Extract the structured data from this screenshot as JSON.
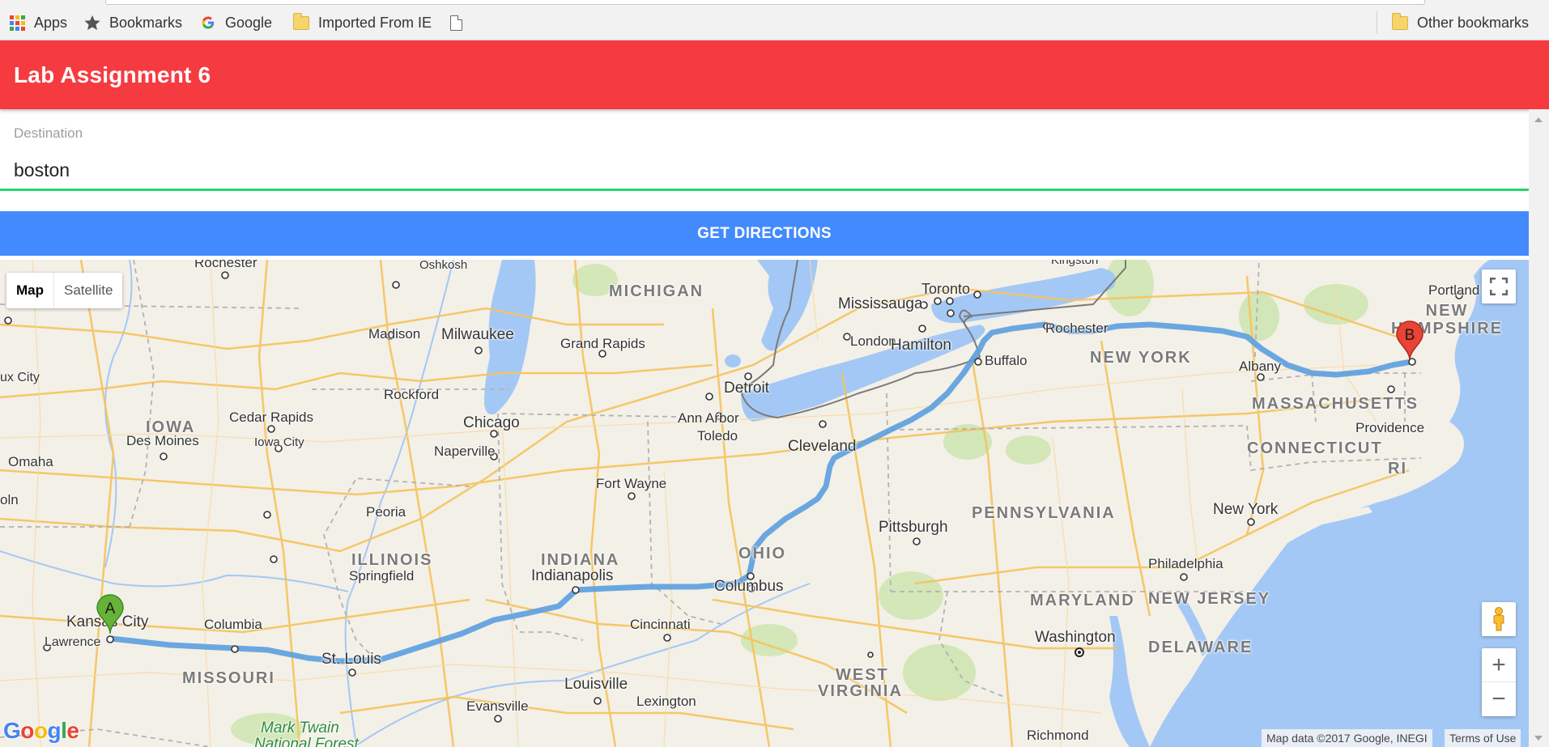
{
  "bookmarks_bar": {
    "items": [
      {
        "label": "Apps",
        "icon": "apps-grid-icon"
      },
      {
        "label": "Bookmarks",
        "icon": "star-icon"
      },
      {
        "label": "Google",
        "icon": "google-g-icon"
      },
      {
        "label": "Imported From IE",
        "icon": "folder-icon"
      },
      {
        "label": "",
        "icon": "page-icon"
      }
    ],
    "other": {
      "label": "Other bookmarks",
      "icon": "folder-icon"
    }
  },
  "header": {
    "title": "Lab Assignment 6",
    "color": "#f63b40"
  },
  "form": {
    "destination_label": "Destination",
    "destination_value": "boston",
    "button_label": "GET DIRECTIONS",
    "button_color": "#448aff",
    "input_underline_color": "#26d56a"
  },
  "map": {
    "type_control": {
      "map": "Map",
      "satellite": "Satellite"
    },
    "route_color": "#5b9ee0",
    "markers": {
      "start": "A",
      "end": "B"
    },
    "attribution": "Map data ©2017 Google, INEGI",
    "terms": "Terms of Use",
    "logo": "Google",
    "zoom_in": "+",
    "zoom_out": "−",
    "labels": {
      "rochester_mn": "Rochester",
      "oshkosh": "Oshkosh",
      "michigan": "MICHIGAN",
      "kingston": "Kingston",
      "toronto": "Toronto",
      "mississauga": "Mississauga",
      "portland": "Portland",
      "new_hampshire": "NEW\nHAMPSHIRE",
      "madison": "Madison",
      "milwaukee": "Milwaukee",
      "grand_rapids": "Grand Rapids",
      "london": "London",
      "hamilton": "Hamilton",
      "rochester_ny": "Rochester",
      "sioux_city": "ux City",
      "buffalo": "Buffalo",
      "new_york_state": "NEW YORK",
      "albany": "Albany",
      "rockford": "Rockford",
      "detroit": "Detroit",
      "massachusetts": "MASSACHUSETTS",
      "iowa": "IOWA",
      "cedar_rapids": "Cedar Rapids",
      "chicago": "Chicago",
      "ann_arbor": "Ann Arbor",
      "providence": "Providence",
      "des_moines": "Des Moines",
      "iowa_city": "Iowa City",
      "toledo": "Toledo",
      "cleveland": "Cleveland",
      "connecticut": "CONNECTICUT",
      "naperville": "Naperville",
      "omaha": "Omaha",
      "ri": "RI",
      "fort_wayne": "Fort Wayne",
      "lincoln": "oln",
      "pennsylvania": "PENNSYLVANIA",
      "peoria": "Peoria",
      "new_york_city": "New York",
      "pittsburgh": "Pittsburgh",
      "illinois": "ILLINOIS",
      "indiana": "INDIANA",
      "ohio": "OHIO",
      "springfield": "Springfield",
      "indianapolis": "Indianapolis",
      "philadelphia": "Philadelphia",
      "columbus": "Columbus",
      "maryland": "MARYLAND",
      "new_jersey": "NEW JERSEY",
      "kansas_city": "Kansas City",
      "columbia": "Columbia",
      "cincinnati": "Cincinnati",
      "washington": "Washington",
      "lawrence": "Lawrence",
      "st_louis": "St. Louis",
      "delaware": "DELAWARE",
      "missouri": "MISSOURI",
      "west": "WEST",
      "virginia": "VIRGINIA",
      "louisville": "Louisville",
      "evansville": "Evansville",
      "lexington": "Lexington",
      "mark_twain": "Mark Twain",
      "national_forest": "National Forest",
      "richmond": "Richmond"
    }
  }
}
